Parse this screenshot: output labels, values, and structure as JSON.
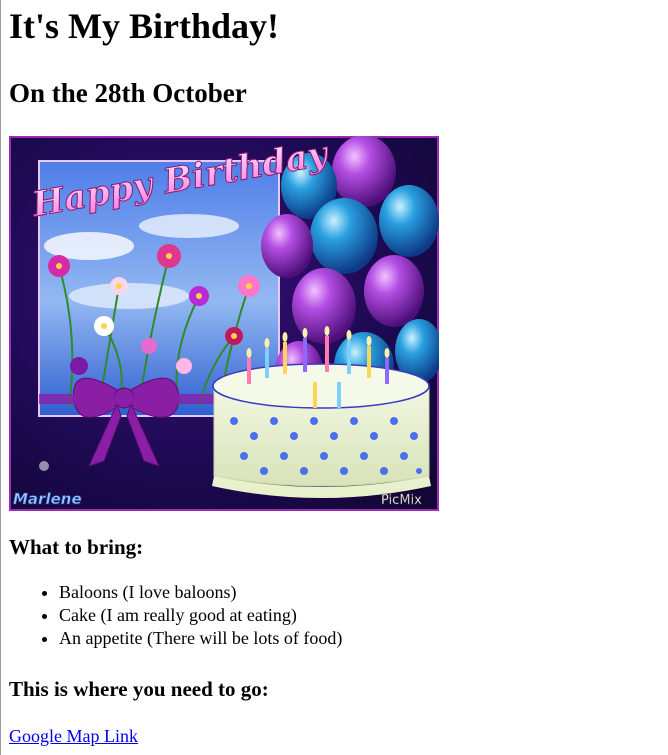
{
  "page": {
    "title": "It's My Birthday!",
    "date_heading": "On the 28th October"
  },
  "image": {
    "greeting": "Happy Birthday",
    "signature": "Marlene",
    "watermark": "PicMix"
  },
  "bring": {
    "heading": "What to bring:",
    "items": [
      "Baloons (I love baloons)",
      "Cake (I am really good at eating)",
      "An appetite (There will be lots of food)"
    ]
  },
  "directions": {
    "heading": "This is where you need to go:",
    "link_label": "Google Map Link"
  },
  "colors": {
    "link": "#0000ee",
    "card_border": "#9b2bb7"
  }
}
